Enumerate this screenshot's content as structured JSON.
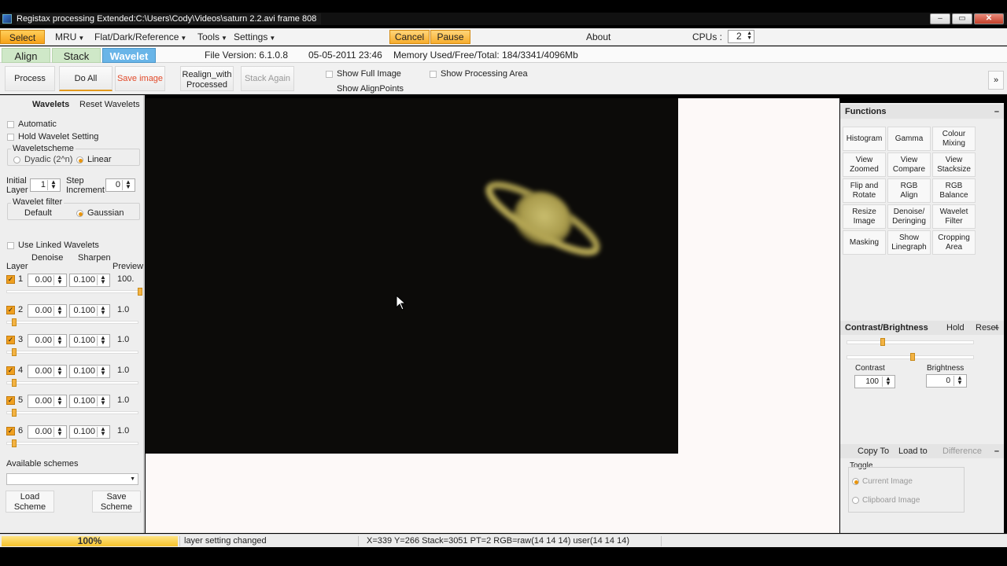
{
  "window": {
    "title": "Registax processing Extended:C:\\Users\\Cody\\Videos\\saturn 2.2.avi frame 808"
  },
  "menubar": {
    "select": "Select",
    "mru": "MRU",
    "flat": "Flat/Dark/Reference",
    "tools": "Tools",
    "settings": "Settings",
    "cancel": "Cancel",
    "pause": "Pause",
    "about": "About",
    "cpus_label": "CPUs :",
    "cpus_value": "2"
  },
  "tabs": {
    "align": "Align",
    "stack": "Stack",
    "wavelet": "Wavelet",
    "file_version": "File Version: 6.1.0.8",
    "date": "05-05-2011 23:46",
    "memory": "Memory Used/Free/Total: 184/3341/4096Mb"
  },
  "toolbar": {
    "process": "Process",
    "do_all": "Do All",
    "save_image": "Save image",
    "realign_line1": "Realign_with",
    "realign_line2": "Processed",
    "stack_again": "Stack Again",
    "show_full_image": "Show Full Image",
    "show_alignpoints": "Show AlignPoints",
    "show_processing_area": "Show Processing Area",
    "expand": "»"
  },
  "left": {
    "wavelets_tab": "Wavelets",
    "reset_tab": "Reset Wavelets",
    "automatic": "Automatic",
    "hold": "Hold Wavelet Setting",
    "scheme_label": "Waveletscheme",
    "dyadic": "Dyadic (2^n)",
    "linear": "Linear",
    "initial_line1": "Initial",
    "initial_line2": "Layer",
    "initial_value": "1",
    "step_line1": "Step",
    "step_line2": "Increment",
    "step_value": "0",
    "filter_label": "Wavelet filter",
    "default": "Default",
    "gaussian": "Gaussian",
    "use_linked": "Use Linked Wavelets",
    "col_layer": "Layer",
    "col_denoise": "Denoise",
    "col_sharpen": "Sharpen",
    "col_preview": "Preview",
    "layers": [
      {
        "num": "1",
        "denoise": "0.00",
        "sharpen": "0.100",
        "preview": "100.",
        "slider": 1.0
      },
      {
        "num": "2",
        "denoise": "0.00",
        "sharpen": "0.100",
        "preview": "1.0",
        "slider": 0.0
      },
      {
        "num": "3",
        "denoise": "0.00",
        "sharpen": "0.100",
        "preview": "1.0",
        "slider": 0.0
      },
      {
        "num": "4",
        "denoise": "0.00",
        "sharpen": "0.100",
        "preview": "1.0",
        "slider": 0.0
      },
      {
        "num": "5",
        "denoise": "0.00",
        "sharpen": "0.100",
        "preview": "1.0",
        "slider": 0.0
      },
      {
        "num": "6",
        "denoise": "0.00",
        "sharpen": "0.100",
        "preview": "1.0",
        "slider": 0.0
      }
    ],
    "available_schemes": "Available schemes",
    "load_line1": "Load",
    "load_line2": "Scheme",
    "save_line1": "Save",
    "save_line2": "Scheme"
  },
  "right": {
    "functions": "Functions",
    "buttons": [
      [
        "Histogram"
      ],
      [
        "Gamma"
      ],
      [
        "Colour",
        "Mixing"
      ],
      [
        "View",
        "Zoomed"
      ],
      [
        "View",
        "Compare"
      ],
      [
        "View",
        "Stacksize"
      ],
      [
        "Flip and",
        "Rotate"
      ],
      [
        "RGB",
        "Align"
      ],
      [
        "RGB",
        "Balance"
      ],
      [
        "Resize",
        "Image"
      ],
      [
        "Denoise/",
        "Deringing"
      ],
      [
        "Wavelet",
        "Filter"
      ],
      [
        "Masking"
      ],
      [
        "Show",
        "Linegraph"
      ],
      [
        "Cropping",
        "Area"
      ]
    ],
    "cb_header": "Contrast/Brightness",
    "hold": "Hold",
    "reset": "Reset",
    "contrast_label": "Contrast",
    "contrast_value": "100",
    "brightness_label": "Brightness",
    "brightness_value": "0",
    "copy_to": "Copy To",
    "load_to": "Load to",
    "difference": "Difference",
    "toggle_label": "Toggle",
    "current_image": "Current Image",
    "clipboard_image": "Clipboard Image"
  },
  "status": {
    "progress": "100%",
    "progress_fraction": 1.0,
    "message": "layer setting changed",
    "coords": "X=339 Y=266 Stack=3051 PT=2 RGB=raw(14 14 14) user(14 14 14)"
  },
  "colors": {
    "accent_orange": "#f6a21a",
    "tab_active": "#69b5e8",
    "tab_inactive": "#cfe8c8",
    "image_bg": "#0c0b09",
    "planet": "#b7a85a"
  }
}
